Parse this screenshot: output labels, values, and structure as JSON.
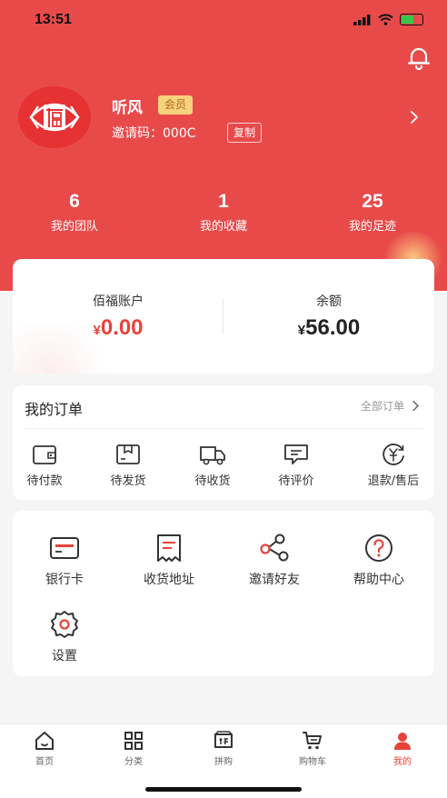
{
  "status_bar": {
    "time": "13:51"
  },
  "profile": {
    "name": "听风",
    "badge": "会员",
    "invite_label": "邀请码：",
    "invite_code": "000C",
    "copy_label": "复制",
    "avatar_icon": "fu-logo-icon"
  },
  "stats": [
    {
      "value": "6",
      "label": "我的团队"
    },
    {
      "value": "1",
      "label": "我的收藏"
    },
    {
      "value": "25",
      "label": "我的足迹"
    }
  ],
  "account": {
    "left": {
      "label": "佰福账户",
      "currency": "¥",
      "amount": "0.00"
    },
    "right": {
      "label": "余额",
      "currency": "¥",
      "amount": "56.00"
    }
  },
  "orders": {
    "title": "我的订单",
    "all_label": "全部订单",
    "items": [
      {
        "label": "待付款",
        "icon": "wallet-icon"
      },
      {
        "label": "待发货",
        "icon": "package-icon"
      },
      {
        "label": "待收货",
        "icon": "truck-icon"
      },
      {
        "label": "待评价",
        "icon": "comment-icon"
      },
      {
        "label": "退款/售后",
        "icon": "refund-icon"
      }
    ]
  },
  "services": [
    {
      "label": "银行卡",
      "icon": "bank-card-icon"
    },
    {
      "label": "收货地址",
      "icon": "address-icon"
    },
    {
      "label": "邀请好友",
      "icon": "share-icon"
    },
    {
      "label": "帮助中心",
      "icon": "help-icon"
    },
    {
      "label": "设置",
      "icon": "settings-icon"
    }
  ],
  "tabs": [
    {
      "label": "首页",
      "icon": "home-icon",
      "active": false
    },
    {
      "label": "分类",
      "icon": "category-icon",
      "active": false
    },
    {
      "label": "拼购",
      "icon": "group-buy-icon",
      "active": false
    },
    {
      "label": "购物车",
      "icon": "cart-icon",
      "active": false
    },
    {
      "label": "我的",
      "icon": "profile-icon",
      "active": true
    }
  ],
  "colors": {
    "brand_red": "#e84a4a",
    "accent_red": "#e8433a",
    "badge_gold": "#f6d27f"
  }
}
